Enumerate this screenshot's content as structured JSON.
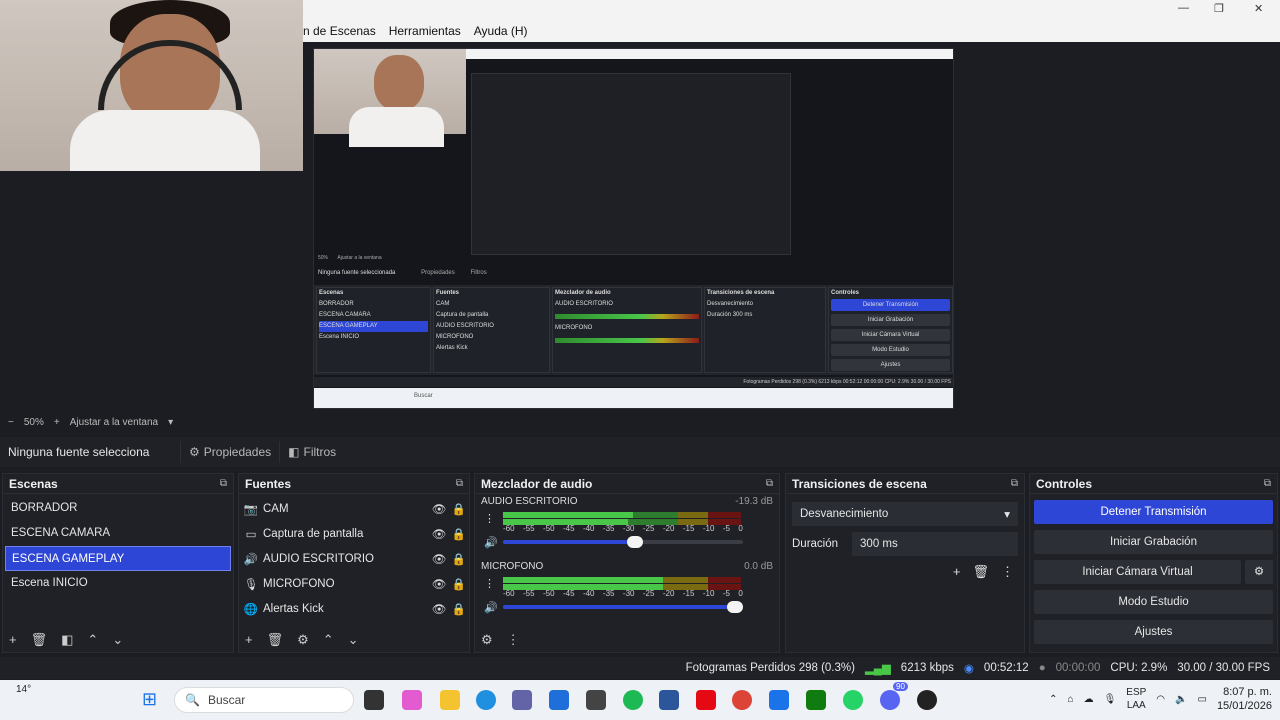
{
  "menu": {
    "items": [
      "n de Escenas",
      "Herramientas",
      "Ayuda (H)"
    ]
  },
  "window_controls": {
    "min": "—",
    "max": "❐",
    "close": "✕"
  },
  "preview_inner": {
    "no_source": "Ninguna fuente seleccionada",
    "props": "Propiedades",
    "filters": "Filtros",
    "scenes_title": "Escenas",
    "scenes": [
      "BORRADOR",
      "ESCENA CAMARA",
      "ESCENA GAMEPLAY",
      "Escena INICIO"
    ],
    "sources_title": "Fuentes",
    "sources": [
      "CAM",
      "Captura de pantalla",
      "AUDIO ESCRITORIO",
      "MICROFONO",
      "Alertas Kick"
    ],
    "mixer_title": "Mezclador de audio",
    "trans_title": "Transiciones de escena",
    "trans_value": "Desvanecimiento",
    "duration": "Duración",
    "duration_value": "300 ms",
    "controls_title": "Controles",
    "controls": [
      "Detener Transmisión",
      "Iniciar Grabación",
      "Iniciar Cámara Virtual",
      "Modo Estudio",
      "Ajustes"
    ],
    "status": "Fotogramas Perdidos 298 (0.3%)   6213 kbps   00:52:12   00:00:00   CPU: 2.9%   30.00 / 30.00 FPS",
    "zoom": "50%",
    "fit": "Ajustar a la ventana",
    "search": "Buscar"
  },
  "zoom": {
    "minus": "−",
    "value": "50%",
    "plus": "+",
    "fit": "Ajustar a la ventana"
  },
  "toolbar": {
    "no_source": "Ninguna fuente selecciona",
    "properties": "Propiedades",
    "filters": "Filtros"
  },
  "scenes": {
    "title": "Escenas",
    "items": [
      "BORRADOR",
      "ESCENA CAMARA",
      "ESCENA GAMEPLAY",
      "Escena INICIO"
    ],
    "selected": "ESCENA GAMEPLAY"
  },
  "sources": {
    "title": "Fuentes",
    "items": [
      {
        "name": "CAM",
        "icon": "camera-icon"
      },
      {
        "name": "Captura de pantalla",
        "icon": "monitor-icon"
      },
      {
        "name": "AUDIO ESCRITORIO",
        "icon": "speaker-icon"
      },
      {
        "name": "MICROFONO",
        "icon": "microphone-icon"
      },
      {
        "name": "Alertas Kick",
        "icon": "browser-icon"
      }
    ]
  },
  "mixer": {
    "title": "Mezclador de audio",
    "channels": [
      {
        "name": "AUDIO ESCRITORIO",
        "db": "-19.3 dB",
        "volume": 0.55
      },
      {
        "name": "MICROFONO",
        "db": "0.0 dB",
        "volume": 1.0
      }
    ],
    "scale": [
      "-60",
      "-55",
      "-50",
      "-45",
      "-40",
      "-35",
      "-30",
      "-25",
      "-20",
      "-15",
      "-10",
      "-5",
      "0"
    ]
  },
  "transitions": {
    "title": "Transiciones de escena",
    "type": "Desvanecimiento",
    "duration_label": "Duración",
    "duration_value": "300 ms"
  },
  "controls": {
    "title": "Controles",
    "stop_stream": "Detener Transmisión",
    "start_recording": "Iniciar Grabación",
    "start_virtualcam": "Iniciar Cámara Virtual",
    "studio_mode": "Modo Estudio",
    "settings": "Ajustes"
  },
  "status": {
    "dropped": "Fotogramas Perdidos 298 (0.3%)",
    "bitrate": "6213 kbps",
    "stream_time": "00:52:12",
    "rec_time": "00:00:00",
    "cpu": "CPU: 2.9%",
    "fps": "30.00 / 30.00 FPS"
  },
  "taskbar": {
    "weather": "14°",
    "search": "Buscar",
    "lang_top": "ESP",
    "lang_bottom": "LAA",
    "time": "8:07 p. m.",
    "date": "15/01/2026",
    "badge": "90"
  },
  "colors": {
    "accent": "#2e46d6",
    "panel": "#1f2127",
    "bg": "#1b1d22"
  }
}
